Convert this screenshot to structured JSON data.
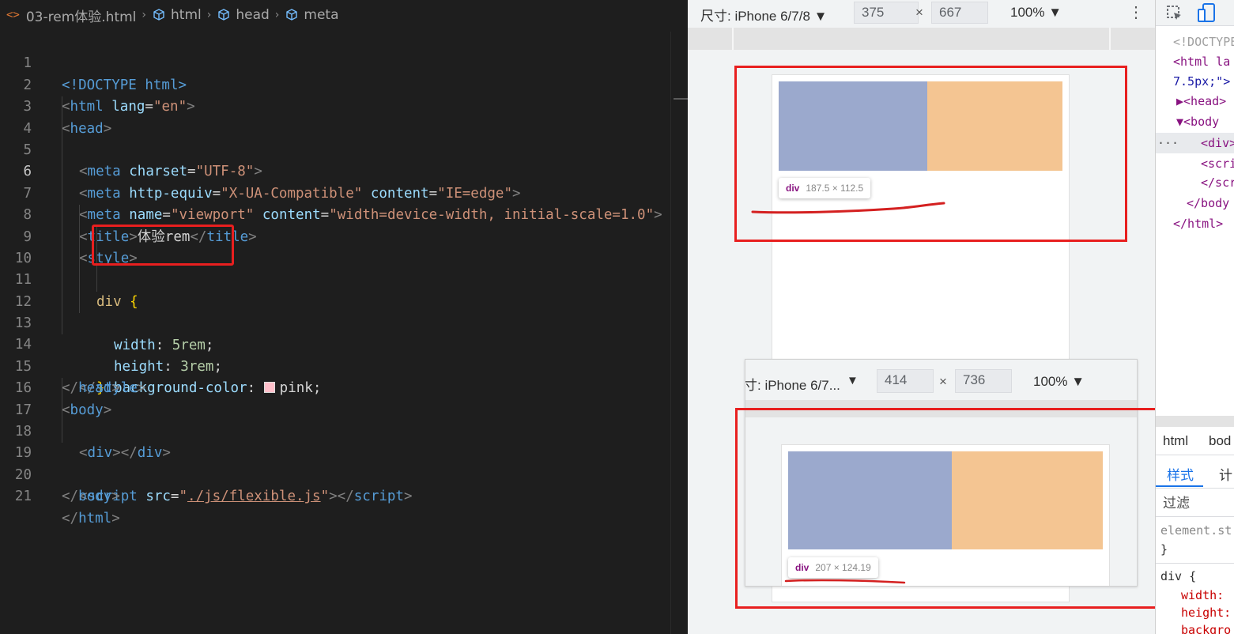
{
  "breadcrumb": {
    "file": "03-rem体验.html",
    "items": [
      "html",
      "head",
      "meta"
    ]
  },
  "code": {
    "line_numbers": [
      "1",
      "2",
      "3",
      "4",
      "5",
      "6",
      "7",
      "8",
      "9",
      "10",
      "11",
      "12",
      "13",
      "14",
      "15",
      "16",
      "17",
      "18",
      "19",
      "20",
      "21"
    ],
    "active_line": "6",
    "doctype": "<!DOCTYPE html>",
    "html_lang": "en",
    "charset": "UTF-8",
    "http_equiv": "X-UA-Compatible",
    "ie_content": "IE=edge",
    "vp_name": "viewport",
    "vp_content": "width=device-width, initial-scale=1.0",
    "title": "体验rem",
    "selector": "div",
    "width_prop": "width",
    "width_val": "5rem",
    "height_prop": "height",
    "height_val": "3rem",
    "bg_prop": "background-color",
    "bg_val": "pink",
    "script_src": "./js/flexible.js"
  },
  "emulator1": {
    "device_label": "尺寸: iPhone 6/7/8 ▼",
    "width": "375",
    "height": "667",
    "times": "×",
    "zoom": "100% ▼",
    "kebab": "⋮",
    "tooltip_tag": "div",
    "tooltip_size": "187.5 × 112.5"
  },
  "emulator2": {
    "device_label": "寸: iPhone 6/7...",
    "caret": "▼",
    "width": "414",
    "height": "736",
    "times": "×",
    "zoom": "100% ▼",
    "tooltip_tag": "div",
    "tooltip_size": "207 × 124.19"
  },
  "devtools": {
    "dom_lines": [
      "<!DOCTYPE",
      "<html la",
      "7.5px;\">",
      "▶<head>",
      "▼<body",
      "<div>",
      "<scri",
      "</scr",
      "</body",
      "</html>"
    ],
    "ellipsis": "···",
    "breadcrumb_html": "html",
    "breadcrumb_body": "bod",
    "tab_styles": "样式",
    "tab_computed": "计",
    "filter": "过滤",
    "element_style": "element.st",
    "close_brace": "}",
    "rule_selector": "div {",
    "rule_width": "width:",
    "rule_height": "height:",
    "rule_bg": "backgro"
  },
  "colors": {
    "annotation_red": "#e81f1f",
    "pink_block": "#f4c592",
    "blue_overlay": "#9ba9cd"
  }
}
